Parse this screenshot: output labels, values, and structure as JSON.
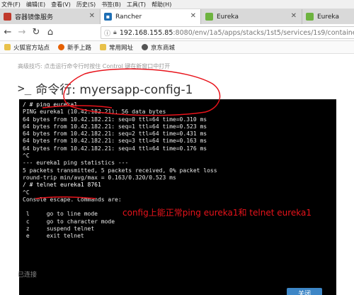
{
  "menubar": {
    "items": [
      "文件(F)",
      "编辑(E)",
      "查看(V)",
      "历史(S)",
      "书签(B)",
      "工具(T)",
      "帮助(H)"
    ]
  },
  "tabs": [
    {
      "title": "容器镜像服务",
      "icon": "aliyun-icon",
      "active": false
    },
    {
      "title": "Rancher",
      "icon": "rancher-icon",
      "active": true
    },
    {
      "title": "Eureka",
      "icon": "eureka-leaf-icon",
      "active": false
    },
    {
      "title": "Eureka",
      "icon": "eureka-leaf-icon",
      "active": false
    }
  ],
  "nav": {
    "url_host": "192.168.155.85",
    "url_path": ":8080/env/1a5/apps/stacks/1st5/services/1s9/containers"
  },
  "bookmarks": [
    {
      "label": "火狐官方站点",
      "icon": "folder-icon"
    },
    {
      "label": "新手上路",
      "icon": "firefox-icon"
    },
    {
      "label": "常用网址",
      "icon": "folder-icon"
    },
    {
      "label": "京东商城",
      "icon": "globe-icon"
    }
  ],
  "page": {
    "tip": "高级技巧: 点击运行命令行时按住 Control 键在新窗口中打开",
    "title": "命令行: myersapp-config-1",
    "status": "已连接",
    "close_button": "关闭"
  },
  "terminal": {
    "lines": [
      "/ # ping eureka1",
      "PING eureka1 (10.42.182.21): 56 data bytes",
      "64 bytes from 10.42.182.21: seq=0 ttl=64 time=0.310 ms",
      "64 bytes from 10.42.182.21: seq=1 ttl=64 time=0.523 ms",
      "64 bytes from 10.42.182.21: seq=2 ttl=64 time=0.431 ms",
      "64 bytes from 10.42.182.21: seq=3 ttl=64 time=0.163 ms",
      "64 bytes from 10.42.182.21: seq=4 ttl=64 time=0.176 ms",
      "^C",
      "--- eureka1 ping statistics ---",
      "5 packets transmitted, 5 packets received, 0% packet loss",
      "round-trip min/avg/max = 0.163/0.320/0.523 ms",
      "/ # telnet eureka1 8761",
      "^C",
      "Console escape. Commands are:",
      "",
      " l     go to line mode",
      " c     go to character mode",
      " z     suspend telnet",
      " e     exit telnet"
    ]
  },
  "annotation": {
    "text": "config上能正常ping eureka1和 telnet eureka1",
    "color": "#e8131b"
  }
}
